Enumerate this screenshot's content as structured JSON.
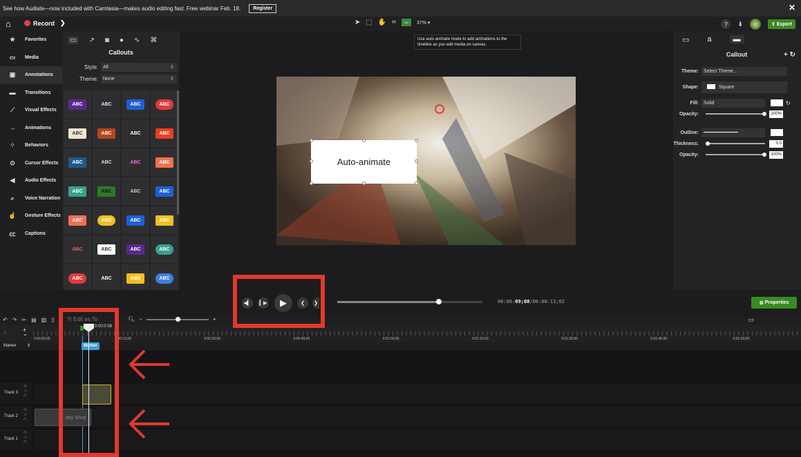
{
  "banner": {
    "text": "See how Audiate—now included with Camtasia—makes audio editing fast. Free webinar Feb. 18.",
    "register_label": "Register",
    "close_glyph": "✕"
  },
  "toolbar": {
    "record_label": "Record",
    "zoom_value": "37%",
    "export_label": "Export",
    "help_label": "?"
  },
  "sidebar": {
    "items": [
      {
        "label": "Favorites",
        "icon": "star-icon",
        "glyph": "★"
      },
      {
        "label": "Media",
        "icon": "media-icon",
        "glyph": "▭"
      },
      {
        "label": "Annotations",
        "icon": "annotations-icon",
        "glyph": "▣"
      },
      {
        "label": "Transitions",
        "icon": "transitions-icon",
        "glyph": "▬"
      },
      {
        "label": "Visual Effects",
        "icon": "visual-effects-icon",
        "glyph": "⟋"
      },
      {
        "label": "Animations",
        "icon": "animations-icon",
        "glyph": "→"
      },
      {
        "label": "Behaviors",
        "icon": "behaviors-icon",
        "glyph": "⁘"
      },
      {
        "label": "Cursor Effects",
        "icon": "cursor-effects-icon",
        "glyph": "⊙"
      },
      {
        "label": "Audio Effects",
        "icon": "audio-effects-icon",
        "glyph": "◀"
      },
      {
        "label": "Voice Narration",
        "icon": "microphone-icon",
        "glyph": "⌕"
      },
      {
        "label": "Gesture Effects",
        "icon": "gesture-icon",
        "glyph": "☝"
      },
      {
        "label": "Captions",
        "icon": "captions-icon",
        "glyph": "㏄"
      }
    ]
  },
  "callouts": {
    "title": "Callouts",
    "style_label": "Style:",
    "style_value": "All",
    "theme_label": "Theme:",
    "theme_value": "None",
    "tiles": [
      {
        "text": "ABC",
        "bg": "#5a2a8a",
        "color": "#fff"
      },
      {
        "text": "ABC",
        "bg": "#2e2e30",
        "color": "#e8e8ff"
      },
      {
        "text": "ABC",
        "bg": "#1f5fd6",
        "color": "#fff"
      },
      {
        "text": "ABC",
        "bg": "#e03a3a",
        "color": "#fff"
      },
      {
        "text": "ABC",
        "bg": "#f0e6d0",
        "color": "#333"
      },
      {
        "text": "ABC",
        "bg": "#b5471a",
        "color": "#fff"
      },
      {
        "text": "ABC",
        "bg": "#2e2e30",
        "color": "#fff"
      },
      {
        "text": "ABC",
        "bg": "#e84020",
        "color": "#fff"
      },
      {
        "text": "ABC",
        "bg": "#1e5a8a",
        "color": "#fff"
      },
      {
        "text": "ABC",
        "bg": "#2e2e30",
        "color": "#ddd"
      },
      {
        "text": "ABC",
        "bg": "#2e2e30",
        "color": "#f070e0"
      },
      {
        "text": "ABC",
        "bg": "#f07050",
        "color": "#fff"
      },
      {
        "text": "ABC",
        "bg": "#3aa090",
        "color": "#fff"
      },
      {
        "text": "ABC",
        "bg": "#2a7a2a",
        "color": "#111"
      },
      {
        "text": "ABC",
        "bg": "#2e2e30",
        "color": "#ccc"
      },
      {
        "text": "ABC",
        "bg": "#1f5fd6",
        "color": "#fff"
      },
      {
        "text": "ABC",
        "bg": "#f07050",
        "color": "#fff"
      },
      {
        "text": "ABC",
        "bg": "#f0c020",
        "color": "#fff"
      },
      {
        "text": "ABC",
        "bg": "#1f5fd6",
        "color": "#fff"
      },
      {
        "text": "ABC",
        "bg": "#f0c020",
        "color": "#fff"
      },
      {
        "text": "ABC",
        "bg": "#2e2e30",
        "color": "#f06060"
      },
      {
        "text": "ABC",
        "bg": "#ffffff",
        "color": "#333"
      },
      {
        "text": "ABC",
        "bg": "#5a2a8a",
        "color": "#fff"
      },
      {
        "text": "ABC",
        "bg": "#3aa090",
        "color": "#fff"
      },
      {
        "text": "ABC",
        "bg": "#e03a3a",
        "color": "#fff"
      },
      {
        "text": "ABC",
        "bg": "#2e2e30",
        "color": "#fff"
      },
      {
        "text": "ABC",
        "bg": "#f0c020",
        "color": "#fff"
      },
      {
        "text": "ABC",
        "bg": "#3a80e0",
        "color": "#fff"
      }
    ]
  },
  "canvas": {
    "tooltip": "Use auto animate mode to add animations to the timeline as you edit media on canvas.",
    "callout_text": "Auto-animate"
  },
  "properties": {
    "title": "Callout",
    "theme_label": "Theme:",
    "theme_value": "Select Theme...",
    "shape_label": "Shape:",
    "shape_value": "Square",
    "fill_label": "Fill:",
    "fill_value": "Solid",
    "opacity_label": "Opacity:",
    "opacity_value": "100%",
    "outline_label": "Outline:",
    "thickness_label": "Thickness:",
    "thickness_value": "0.0",
    "opacity2_label": "Opacity:",
    "opacity2_value": "100%"
  },
  "playback": {
    "timecode_prefix": "00:00:",
    "timecode_bold": "09;08",
    "timecode_suffix": "/00:00:13;02",
    "progress_fraction": 0.7,
    "properties_label": "Properties"
  },
  "timeline": {
    "edit_label": "Edit as To",
    "playhead_label": "0:00:0  08",
    "marker_row_label": "Marker",
    "marker_badge": "Marker",
    "ruler_labels": [
      "0:00:00;00",
      "0:00:15;00",
      "0:00:30;00",
      "0:00:45;00",
      "0:01:00;00",
      "0:01:15;00",
      "0:01:30;00",
      "0:01:45;00",
      "0:02:00;00"
    ],
    "tracks": [
      {
        "label": "Track 3"
      },
      {
        "label": "Track 2"
      },
      {
        "label": "Track 1"
      }
    ],
    "media_clip_label": "day Shop"
  }
}
